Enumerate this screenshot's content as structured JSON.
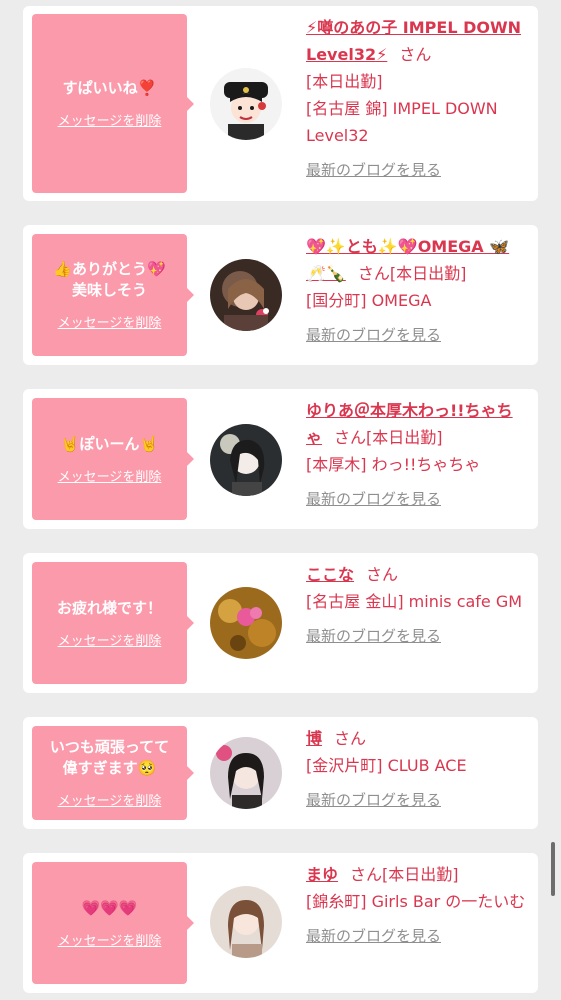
{
  "entries": [
    {
      "message": "すぱいいね❣️",
      "delete_label": "メッセージを削除",
      "name": "⚡噂のあの子 IMPEL DOWN Level32⚡",
      "san": "さん",
      "status": "[本日出勤]",
      "shop": "[名古屋 錦] IMPEL DOWN Level32",
      "blog_link": "最新のブログを見る"
    },
    {
      "message": "👍ありがとう💖\n美味しそう",
      "delete_label": "メッセージを削除",
      "name": "💖✨とも✨💖OMEGA 🦋🥂🍾",
      "san": "さん",
      "status": "[本日出勤]",
      "shop": "[国分町] OMEGA",
      "blog_link": "最新のブログを見る"
    },
    {
      "message": "🤘ぽいーん🤘",
      "delete_label": "メッセージを削除",
      "name": "ゆりあ＠本厚木わっ!!ちゃちゃ",
      "san": "さん",
      "status": "[本日出勤]",
      "shop": "[本厚木] わっ!!ちゃちゃ",
      "blog_link": "最新のブログを見る"
    },
    {
      "message": "お疲れ様です！",
      "delete_label": "メッセージを削除",
      "name": "ここな",
      "san": "さん",
      "status": "",
      "shop": "[名古屋 金山] minis cafe GM",
      "blog_link": "最新のブログを見る"
    },
    {
      "message": "いつも頑張ってて\n偉すぎます🥺",
      "delete_label": "メッセージを削除",
      "name": "博",
      "san": "さん",
      "status": "",
      "shop": "[金沢片町] CLUB ACE",
      "blog_link": "最新のブログを見る"
    },
    {
      "message": "💗💗💗",
      "delete_label": "メッセージを削除",
      "name": "まゆ",
      "san": "さん",
      "status": "[本日出勤]",
      "shop": "[錦糸町] Girls Bar の一たいむ",
      "blog_link": "最新のブログを見る"
    }
  ]
}
